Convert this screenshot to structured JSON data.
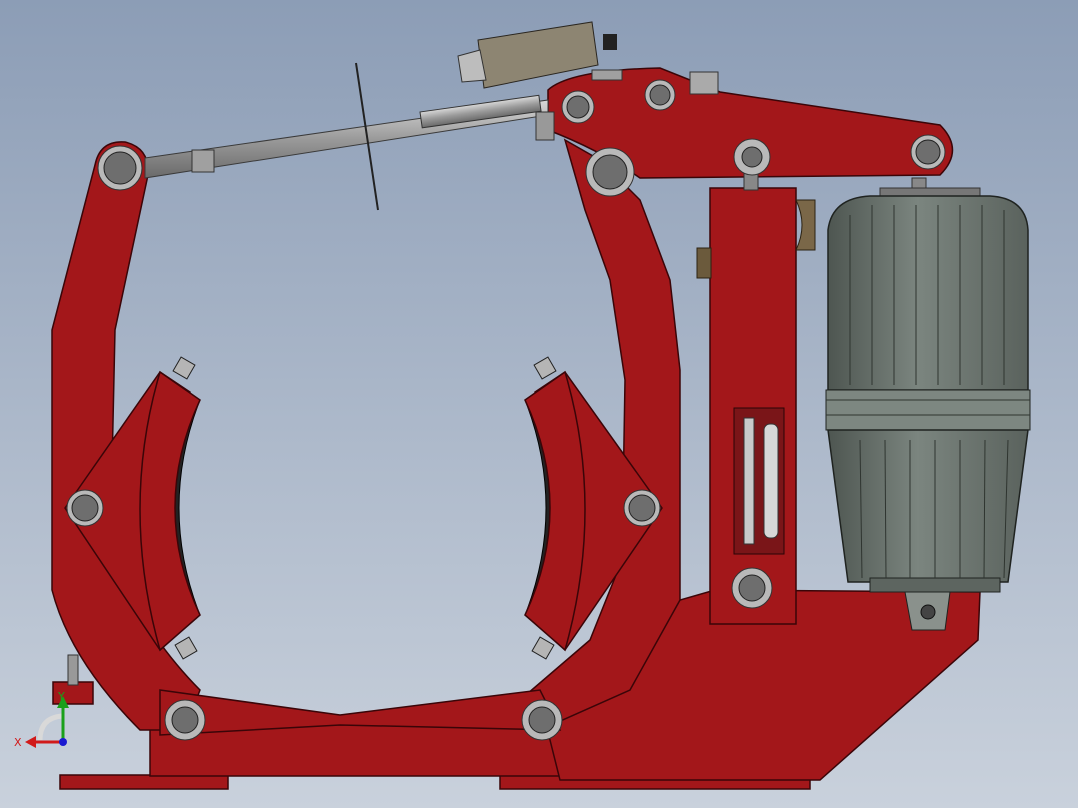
{
  "colors": {
    "background_top": "#8c9db6",
    "background_bottom": "#c9d1dc",
    "frame_red": "#a3171a",
    "frame_edge": "#3a0508",
    "pin_gray": "#6e6e6e",
    "pin_ring": "#b9b9b9",
    "lining_black": "#222222",
    "thruster_gray": "#6d7570",
    "rod_gray": "#a9a9a9",
    "axis_x_color": "#d11a1a",
    "axis_y_color": "#1aa01a",
    "axis_z_color": "#1a1ad1"
  },
  "triad": {
    "x_label": "X",
    "y_label": "Y"
  }
}
